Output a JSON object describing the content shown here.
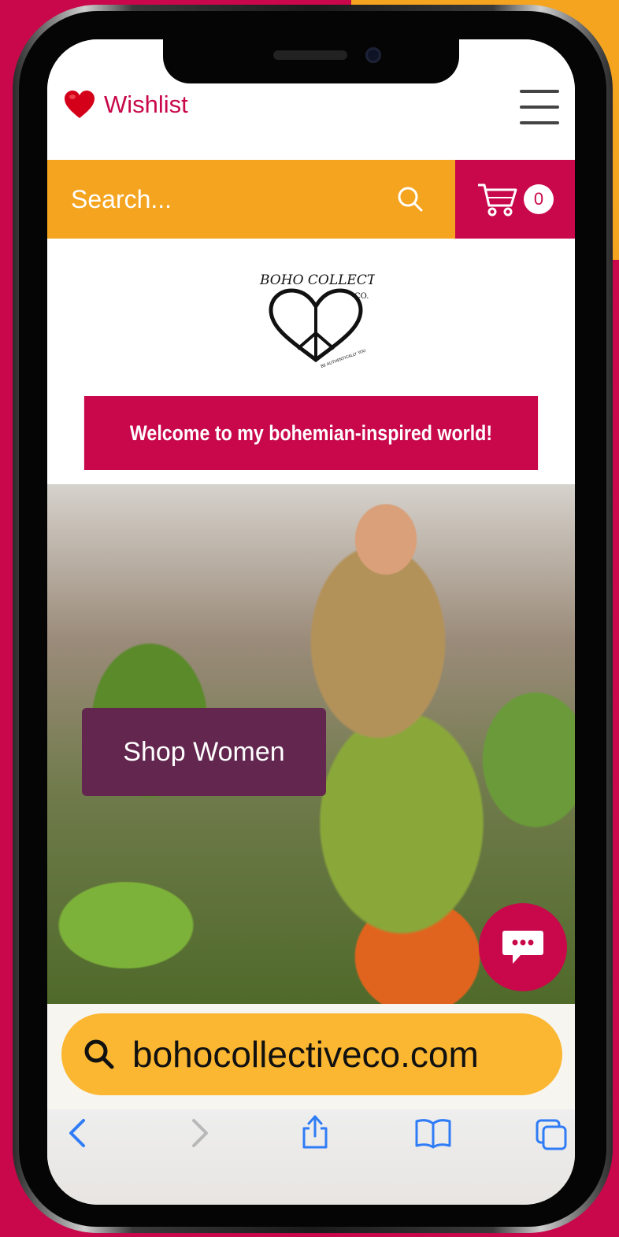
{
  "header": {
    "wishlist_label": "Wishlist",
    "menu_icon": "hamburger-icon",
    "heart_icon": "heart-icon"
  },
  "search": {
    "placeholder": "Search...",
    "icon": "search-icon"
  },
  "cart": {
    "icon": "cart-icon",
    "count": "0"
  },
  "logo": {
    "text": "BOHO COLLECTIVE CO.",
    "tagline": "BE AUTHENTICALLY YOU"
  },
  "banner": {
    "welcome_text": "Welcome to my bohemian-inspired world!"
  },
  "hero": {
    "cta_label": "Shop Women",
    "chat_icon": "chat-icon"
  },
  "browser": {
    "url": "bohocollectiveco.com",
    "url_search_icon": "search-icon",
    "toolbar": [
      "back-icon",
      "forward-icon",
      "share-icon",
      "bookmarks-icon",
      "tabs-icon"
    ]
  },
  "colors": {
    "brand_pink": "#c8084a",
    "brand_orange": "#f4a41e",
    "cta_purple": "#63274f",
    "url_bar_yellow": "#fbb731"
  }
}
